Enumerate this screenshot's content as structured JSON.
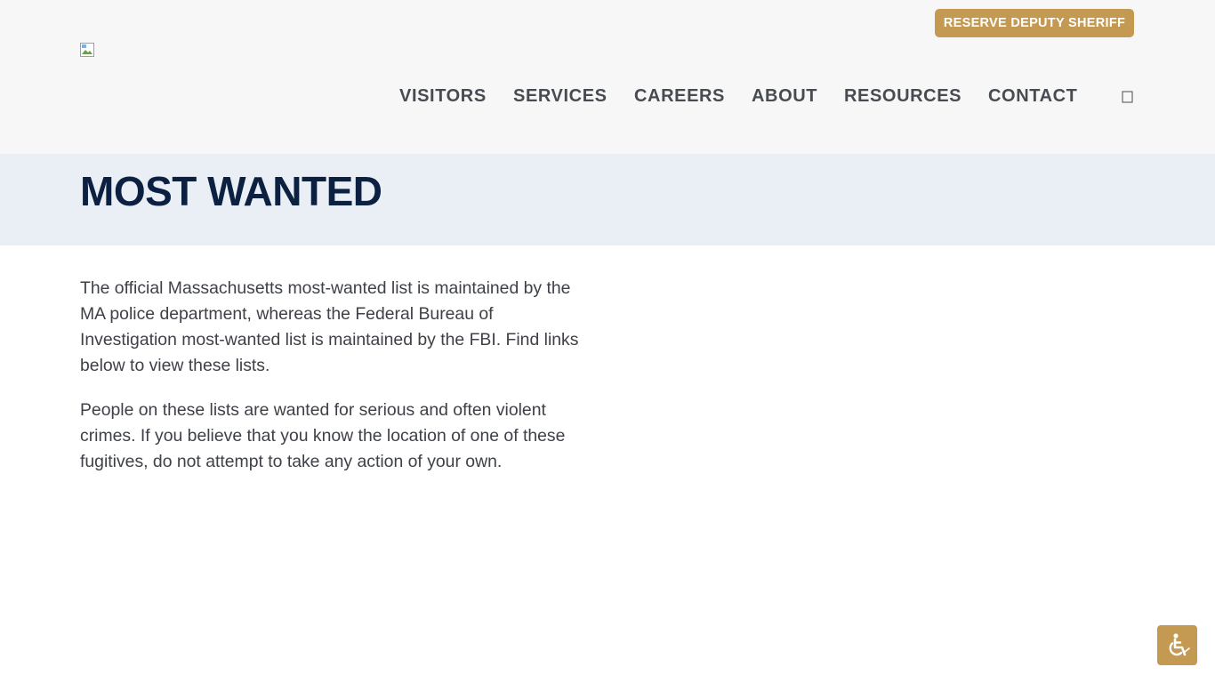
{
  "header": {
    "reserve_button": "RESERVE DEPUTY SHERIFF",
    "logo_icon": "broken-image-icon",
    "nav": [
      "VISITORS",
      "SERVICES",
      "CAREERS",
      "ABOUT",
      "RESOURCES",
      "CONTACT"
    ],
    "search_icon": "search-icon"
  },
  "page": {
    "title": "MOST WANTED",
    "paragraphs": [
      "The official Massachusetts most-wanted list is maintained by the MA police department, whereas the Federal Bureau of Investigation most-wanted list is maintained by the FBI. Find links below to view these lists.",
      "People on these lists are wanted for serious and often violent crimes. If you believe that you know the location of one of these fugitives, do not attempt to take any action of your own."
    ]
  },
  "accessibility": {
    "icon": "wheelchair-icon"
  },
  "colors": {
    "accent": "#c49a52",
    "title": "#0c2142",
    "header_bg": "#f7f7f7",
    "band_bg": "#eaeff6",
    "nav_text": "#474b52"
  }
}
